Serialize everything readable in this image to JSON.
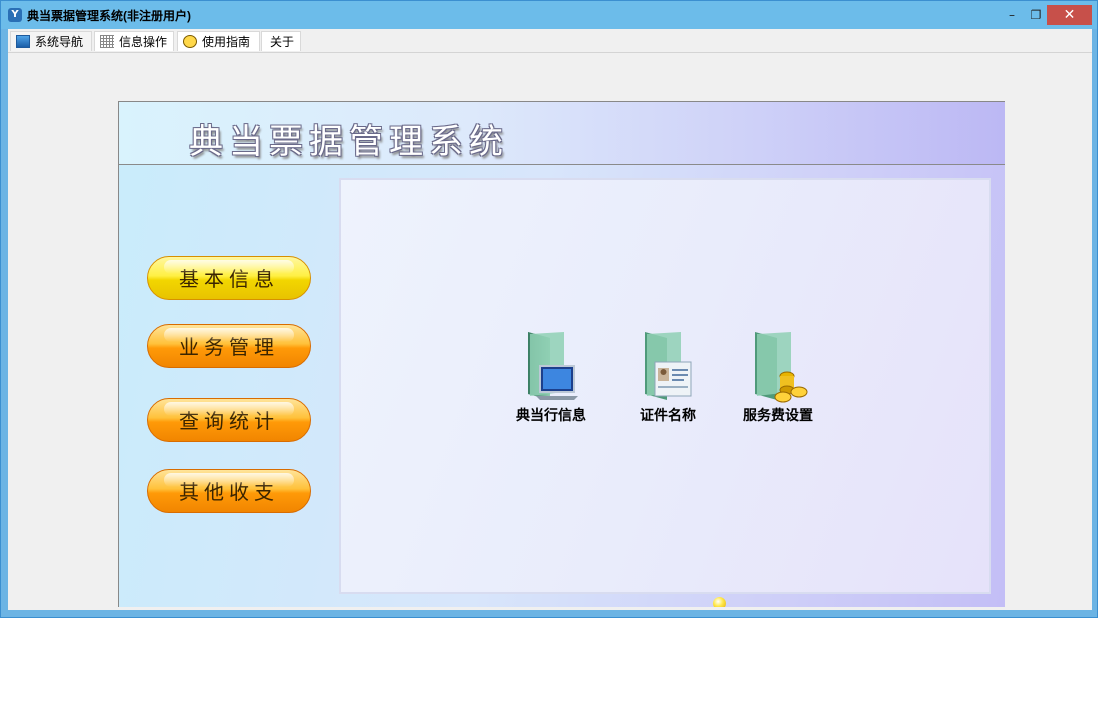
{
  "window": {
    "title": "典当票据管理系统(非注册用户)",
    "minimize": "–",
    "maximize": "❐",
    "close": "✕"
  },
  "tabs": [
    {
      "label": "系统导航",
      "icon": "monitor-icon"
    },
    {
      "label": "信息操作",
      "icon": "grid-icon"
    },
    {
      "label": "使用指南",
      "icon": "clock-icon"
    },
    {
      "label": "关于"
    }
  ],
  "banner": {
    "title": "典当票据管理系统"
  },
  "side_menu": [
    {
      "label": "基本信息",
      "color": "#fff044"
    },
    {
      "label": "业务管理",
      "color": "#ff9a08"
    },
    {
      "label": "查询统计",
      "color": "#ff9a08"
    },
    {
      "label": "其他收支",
      "color": "#ff9a08"
    }
  ],
  "items": [
    {
      "label": "典当行信息",
      "icon": "folder-monitor-icon"
    },
    {
      "label": "证件名称",
      "icon": "folder-id-card-icon"
    },
    {
      "label": "服务费设置",
      "icon": "folder-coins-icon"
    }
  ]
}
